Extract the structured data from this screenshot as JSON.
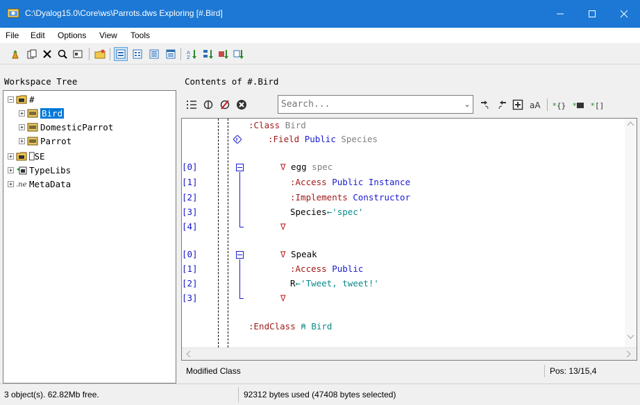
{
  "window": {
    "title": "C:\\Dyalog15.0\\Core\\ws\\Parrots.dws Exploring [#.Bird]"
  },
  "menu": [
    "File",
    "Edit",
    "Options",
    "View",
    "Tools"
  ],
  "left_pane": {
    "title": "Workspace Tree",
    "tree": [
      {
        "label": "#",
        "icon": "namespace-icon",
        "expander": "minus"
      },
      {
        "label": "Bird",
        "icon": "class-icon",
        "expander": "plus",
        "selected": true
      },
      {
        "label": "DomesticParrot",
        "icon": "class-icon",
        "expander": "plus"
      },
      {
        "label": "Parrot",
        "icon": "class-icon",
        "expander": "plus"
      },
      {
        "label": "⎕SE",
        "icon": "namespace-icon",
        "expander": "plus"
      },
      {
        "label": "TypeLibs",
        "icon": "typelibs-icon",
        "expander": "plus"
      },
      {
        "label": "MetaData",
        "icon": "net-icon",
        "expander": "plus"
      }
    ]
  },
  "right_pane": {
    "title": "Contents of #.Bird",
    "search": {
      "placeholder": "Search..."
    },
    "code": [
      {
        "num": "",
        "text": ":Class Bird"
      },
      {
        "num": "",
        "text": ":Field Public Species"
      },
      {
        "num": "",
        "text": ""
      },
      {
        "num": "[0]",
        "text": "∇ egg spec"
      },
      {
        "num": "[1]",
        "text": ":Access Public Instance"
      },
      {
        "num": "[2]",
        "text": ":Implements Constructor"
      },
      {
        "num": "[3]",
        "text": "Species←'spec'"
      },
      {
        "num": "[4]",
        "text": "∇"
      },
      {
        "num": "",
        "text": ""
      },
      {
        "num": "[0]",
        "text": "∇ Speak"
      },
      {
        "num": "[1]",
        "text": ":Access Public"
      },
      {
        "num": "[2]",
        "text": "R←'Tweet, tweet!'"
      },
      {
        "num": "[3]",
        "text": "∇"
      },
      {
        "num": "",
        "text": ""
      },
      {
        "num": "",
        "text": ":EndClass ⍝ Bird"
      }
    ],
    "status": {
      "left": "Modified Class",
      "pos": "Pos: 13/15,4"
    }
  },
  "statusbar": {
    "objects": "3 object(s). 62.82Mb free.",
    "bytes": "92312 bytes used (47408 bytes selected)"
  },
  "colors": {
    "titlebar": "#1c78d4",
    "selection": "#0078d7",
    "line_number": "#1515c8",
    "keyword": "#a11a1a",
    "string": "#0a8a8a"
  }
}
